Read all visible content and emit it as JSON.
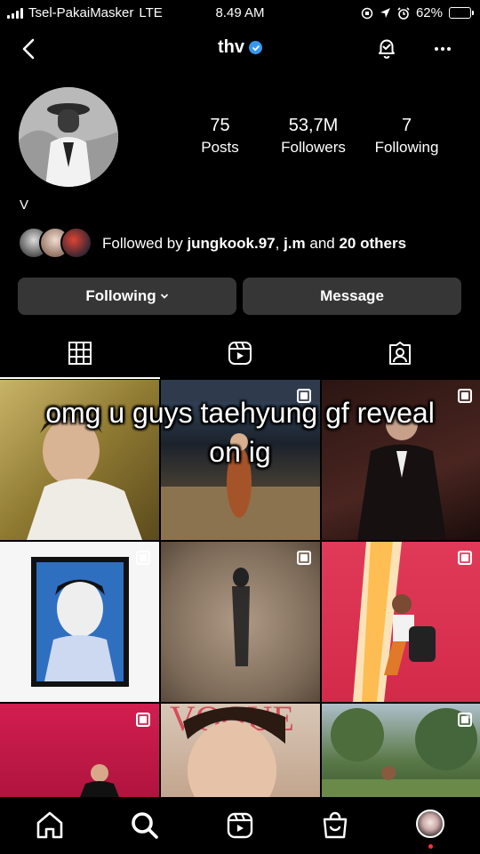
{
  "status_bar": {
    "carrier": "Tsel-PakaiMasker",
    "network": "LTE",
    "time": "8.49 AM",
    "battery_text": "62%",
    "battery_level": 0.62
  },
  "header": {
    "username": "thv",
    "back_icon": "chevron-left-icon",
    "bell_icon": "notification-bell-icon",
    "more_icon": "more-horizontal-icon"
  },
  "profile": {
    "stats": [
      {
        "value": "75",
        "label": "Posts"
      },
      {
        "value": "53,7M",
        "label": "Followers"
      },
      {
        "value": "7",
        "label": "Following"
      }
    ],
    "name": "V",
    "followed_by": {
      "prefix": "Followed by ",
      "user1": "jungkook.97",
      "sep": ", ",
      "user2": "j.m",
      "and": " and ",
      "others": "20 others"
    }
  },
  "buttons": {
    "following": "Following",
    "message": "Message"
  },
  "caption_overlay": "omg u guys taehyung gf reveal on ig",
  "colors": {
    "background": "#000000",
    "button_bg": "#363636",
    "verified_blue": "#3797f0",
    "notification_dot": "#ff3040"
  },
  "nav": {
    "icons": [
      "home-icon",
      "search-icon",
      "reels-icon",
      "shop-icon",
      "profile-avatar"
    ]
  }
}
